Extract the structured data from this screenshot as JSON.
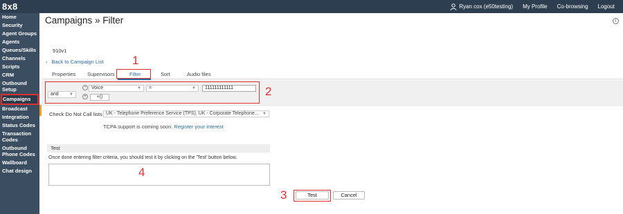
{
  "app": {
    "logo": "8x8"
  },
  "topbar": {
    "user": "Ryan cox (e50testing)",
    "links": [
      "My Profile",
      "Co-browsing",
      "Logout"
    ]
  },
  "sidebar": {
    "items": [
      "Home",
      "Security",
      "Agent Groups",
      "Agents",
      "Queues/Skills",
      "Channels",
      "Scripts",
      "CRM",
      "Outbound Setup",
      "Campaigns",
      "Broadcast",
      "Integration",
      "Status Codes",
      "Transaction Codes",
      "Outbound Phone Codes",
      "Wallboard",
      "Chat design"
    ],
    "active": "Campaigns"
  },
  "page": {
    "title": "Campaigns » Filter",
    "campaign_id": "910v1",
    "back_link": "Back to Campaign List"
  },
  "tabs": [
    "Properties",
    "Supervisors",
    "Filter",
    "Sort",
    "Audio files"
  ],
  "active_tab": "Filter",
  "filter_row": {
    "conjunction": "and",
    "field": "Voice",
    "operator": "=",
    "value": "111111111111",
    "paren_button": "+()",
    "remove_icon": "minus-circle-icon",
    "add_icon": "plus-circle-icon"
  },
  "dnc": {
    "label": "Check Do Not Call lists",
    "selected": "UK - Telephone Preference Service (TPS), UK - Corporate Telephone...",
    "tcpa_text": "TCPA support is coming soon.",
    "tcpa_link": "Register your interest"
  },
  "test_panel": {
    "header": "Test",
    "description": "Once done entering filter criteria, you should test it by clicking on the 'Test' button below."
  },
  "buttons": {
    "test": "Test",
    "cancel": "Cancel"
  },
  "annotations": {
    "a1": "1",
    "a2": "2",
    "a3": "3",
    "a4": "4"
  },
  "colors": {
    "topbar": "#2d3e50",
    "sidebar": "#3a4d61",
    "highlight": "#e03030",
    "link": "#2d6ca2",
    "accent": "#f0a020"
  }
}
